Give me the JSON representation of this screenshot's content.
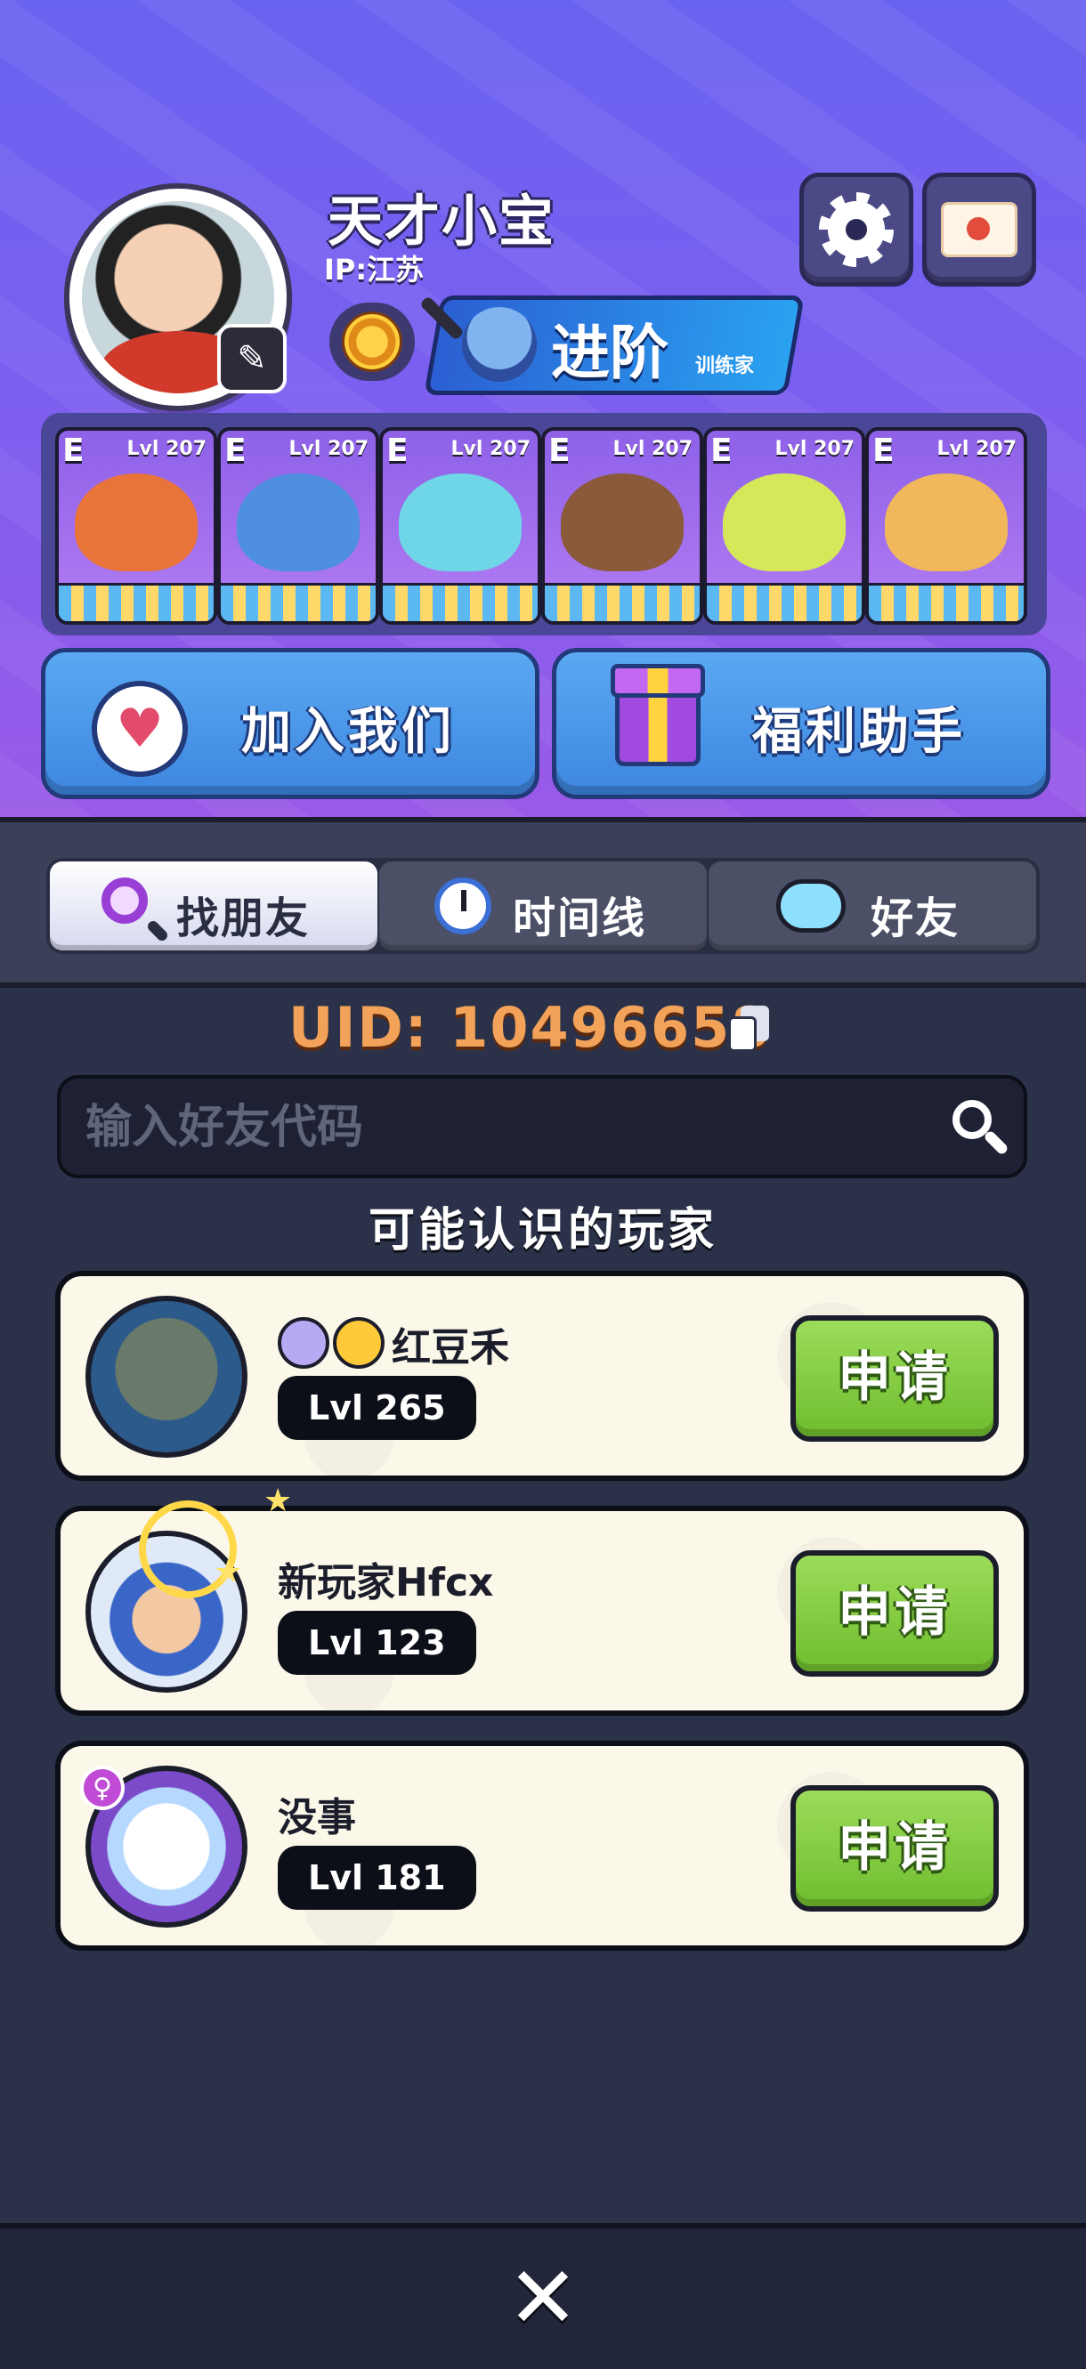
{
  "profile": {
    "username": "天才小宝",
    "ip": "IP:江苏",
    "advance_label": "进阶",
    "advance_sub": "训练家"
  },
  "team": [
    {
      "grade": "E",
      "level": "Lvl 207",
      "color": "#e8743a"
    },
    {
      "grade": "E",
      "level": "Lvl 207",
      "color": "#4f8fe0"
    },
    {
      "grade": "E",
      "level": "Lvl 207",
      "color": "#6fd6e8"
    },
    {
      "grade": "E",
      "level": "Lvl 207",
      "color": "#8a5a3a"
    },
    {
      "grade": "E",
      "level": "Lvl 207",
      "color": "#d6e85a"
    },
    {
      "grade": "E",
      "level": "Lvl 207",
      "color": "#f0b85a"
    }
  ],
  "actions": {
    "join_label": "加入我们",
    "welfare_label": "福利助手"
  },
  "tabs": [
    {
      "label": "找朋友",
      "active": true
    },
    {
      "label": "时间线",
      "active": false
    },
    {
      "label": "好友",
      "active": false
    }
  ],
  "uid_text": "UID: 10496658",
  "search": {
    "placeholder": "输入好友代码"
  },
  "section_title": "可能认识的玩家",
  "players": [
    {
      "name": "红豆禾",
      "level": "Lvl 265",
      "apply": "申请"
    },
    {
      "name": "新玩家Hfcx",
      "level": "Lvl 123",
      "apply": "申请"
    },
    {
      "name": "没事",
      "level": "Lvl 181",
      "apply": "申请"
    }
  ],
  "colors": {
    "accent_green": "#7cc63c",
    "uid_orange": "#f3a25a",
    "header_purple": "#7a5ff0"
  }
}
